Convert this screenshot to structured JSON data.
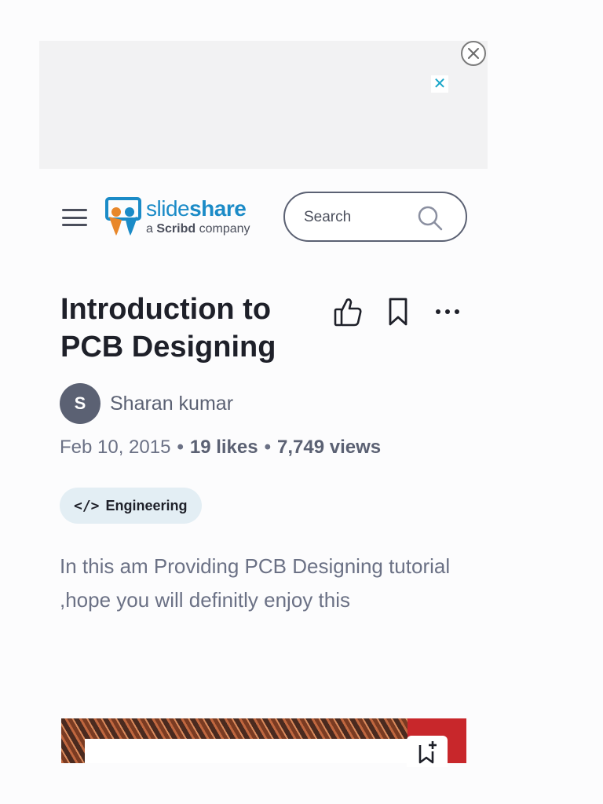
{
  "ad": {
    "close_glyph": "✕"
  },
  "header": {
    "logo": {
      "word_part1": "slide",
      "word_part2": "share",
      "tagline_prefix": "a ",
      "tagline_brand": "Scribd",
      "tagline_suffix": " company"
    },
    "search": {
      "placeholder": "Search"
    }
  },
  "document": {
    "title": "Introduction to PCB Designing",
    "author": {
      "initial": "S",
      "name": "Sharan kumar"
    },
    "meta": {
      "date": "Feb 10, 2015",
      "likes": "19 likes",
      "views": "7,749 views"
    },
    "category": {
      "icon": "</>",
      "label": "Engineering"
    },
    "description": "In this am Providing PCB Designing tutorial ,hope you will definitly enjoy this"
  },
  "colors": {
    "brand_blue": "#1b8bc7",
    "text_dark": "#1e2029",
    "text_muted": "#6b7185",
    "chip_bg": "#e3eef4",
    "ad_close": "#19a6c9"
  },
  "icons": {
    "menu": "hamburger-icon",
    "search": "search-icon",
    "like": "thumbs-up-icon",
    "save": "bookmark-icon",
    "more": "more-horizontal-icon",
    "dismiss": "close-icon",
    "category": "code-icon",
    "save_slide": "bookmark-plus-icon"
  }
}
